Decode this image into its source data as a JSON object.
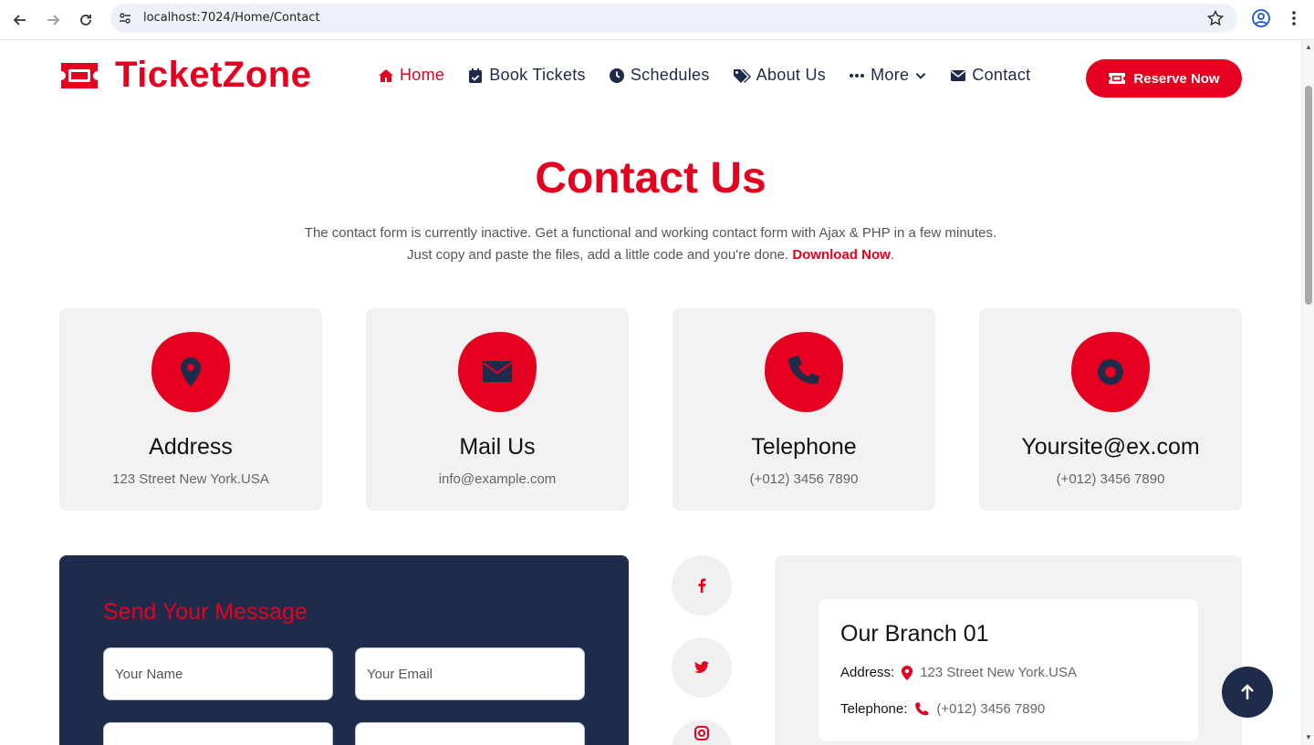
{
  "browser": {
    "url": "localhost:7024/Home/Contact"
  },
  "header": {
    "logo_text": "TicketZone",
    "nav": [
      {
        "label": "Home",
        "icon": "home-icon",
        "active": true
      },
      {
        "label": "Book Tickets",
        "icon": "calendar-check-icon"
      },
      {
        "label": "Schedules",
        "icon": "clock-icon"
      },
      {
        "label": "About Us",
        "icon": "tags-icon"
      },
      {
        "label": "More",
        "icon": "ellipsis-icon"
      },
      {
        "label": "Contact",
        "icon": "envelope-icon"
      }
    ],
    "reserve_label": "Reserve Now"
  },
  "hero": {
    "title": "Contact Us",
    "line1": "The contact form is currently inactive. Get a functional and working contact form with Ajax & PHP in a few minutes.",
    "line2": "Just copy and paste the files, add a little code and you're done.",
    "link": "Download Now",
    "after_link": "."
  },
  "cards": [
    {
      "title": "Address",
      "sub": "123 Street New York.USA",
      "icon": "map-pin-icon"
    },
    {
      "title": "Mail Us",
      "sub": "info@example.com",
      "icon": "envelope-icon"
    },
    {
      "title": "Telephone",
      "sub": "(+012) 3456 7890",
      "icon": "phone-icon"
    },
    {
      "title": "Yoursite@ex.com",
      "sub": "(+012) 3456 7890",
      "icon": "share-icon"
    }
  ],
  "form": {
    "title": "Send Your Message",
    "name_placeholder": "Your Name",
    "email_placeholder": "Your Email"
  },
  "social": [
    "facebook-icon",
    "twitter-icon",
    "instagram-icon"
  ],
  "branch": {
    "title": "Our Branch 01",
    "address_label": "Address:",
    "address_value": "123 Street New York.USA",
    "phone_label": "Telephone:",
    "phone_value": "(+012) 3456 7890"
  },
  "colors": {
    "brand": "#e6001f",
    "navy": "#1f2b4b"
  }
}
